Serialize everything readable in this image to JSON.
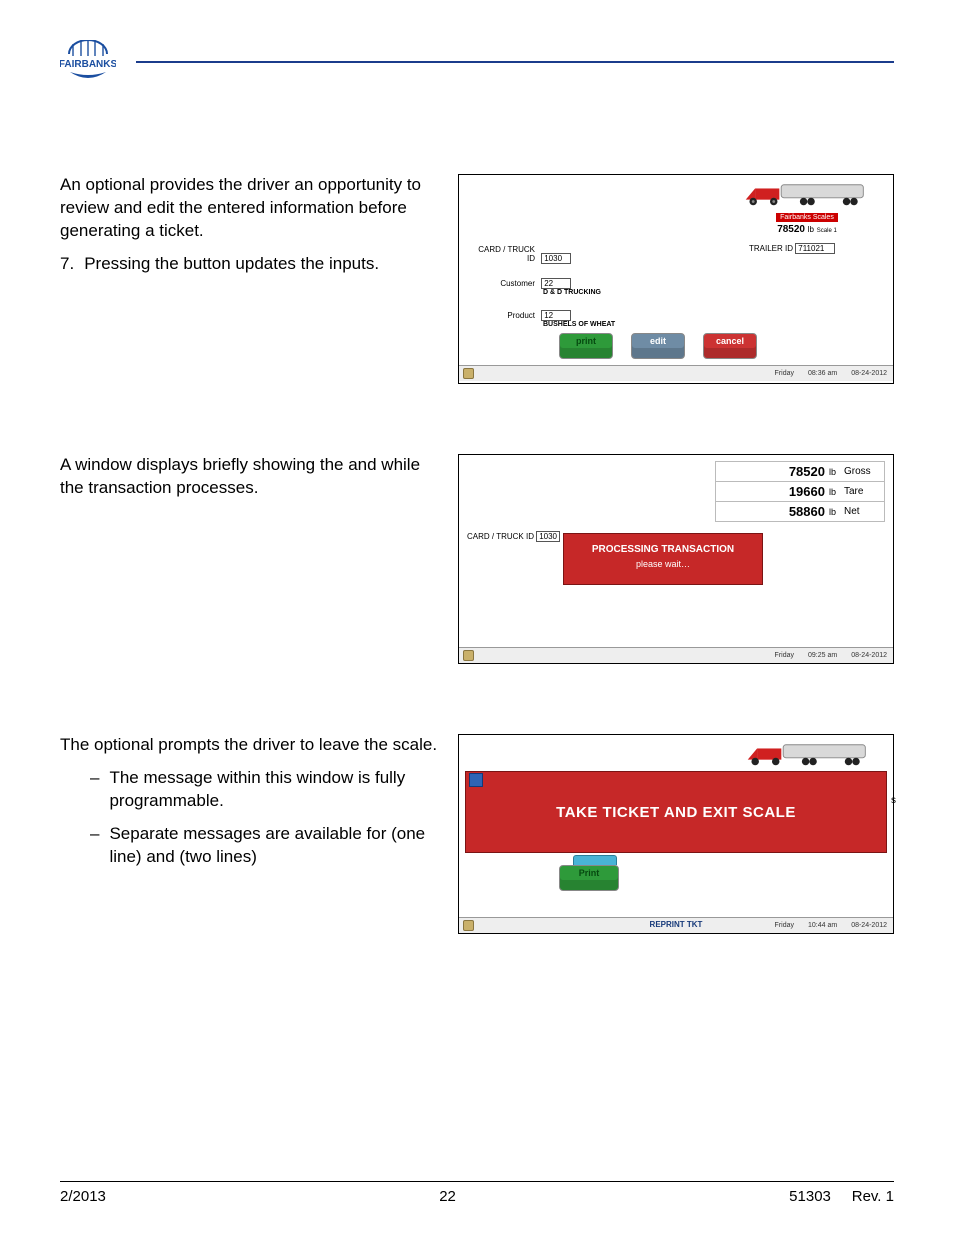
{
  "footer": {
    "date": "2/2013",
    "page": "22",
    "doc": "51303",
    "rev": "Rev. 1"
  },
  "sectionA": {
    "p1a": "An optional ",
    "p1b": " provides the driver an opportunity to review and edit the entered information before generating a ticket.",
    "stepNum": "7.",
    "stepA": "Pressing the ",
    "stepB": " button updates the inputs."
  },
  "shot1": {
    "badge": "Fairbanks Scales",
    "weight": "78520",
    "weightUnit": "lb",
    "weightNote": "Scale 1",
    "trailerLabel": "TRAILER ID",
    "trailerVal": "711021",
    "fields": [
      {
        "lbl": "CARD / TRUCK ID",
        "val": "1030",
        "sub": ""
      },
      {
        "lbl": "Customer",
        "val": "22",
        "sub": "D & D TRUCKING"
      },
      {
        "lbl": "Product",
        "val": "12",
        "sub": "BUSHELS OF WHEAT"
      }
    ],
    "btns": {
      "print": "print",
      "edit": "edit",
      "cancel": "cancel"
    },
    "status": {
      "day": "Friday",
      "time": "08:36 am",
      "date": "08-24-2012"
    }
  },
  "sectionB": {
    "p1a": "A window displays briefly showing the ",
    "p1b": " and ",
    "p1c": " while the transaction processes."
  },
  "shot2": {
    "rows": [
      {
        "num": "78520",
        "un": "lb",
        "ty": "Gross"
      },
      {
        "num": "19660",
        "un": "lb",
        "ty": "Tare"
      },
      {
        "num": "58860",
        "un": "lb",
        "ty": "Net"
      }
    ],
    "cardLabel": "CARD / TRUCK ID",
    "cardVal": "1030",
    "proc1": "PROCESSING TRANSACTION",
    "proc2": "please wait…",
    "status": {
      "day": "Friday",
      "time": "09:25 am",
      "date": "08-24-2012"
    }
  },
  "sectionC": {
    "p1a": "The optional ",
    "p1b": " prompts the driver to leave the scale.",
    "li1": "The message within this window is fully programmable.",
    "li2a": "Separate messages are available for ",
    "li2b": " (one line) and ",
    "li2c": " (two lines)"
  },
  "shot3": {
    "banner": "TAKE TICKET AND EXIT SCALE",
    "s": "s",
    "print": "Print",
    "reprint": "REPRINT TKT",
    "status": {
      "day": "Friday",
      "time": "10:44 am",
      "date": "08-24-2012"
    }
  }
}
